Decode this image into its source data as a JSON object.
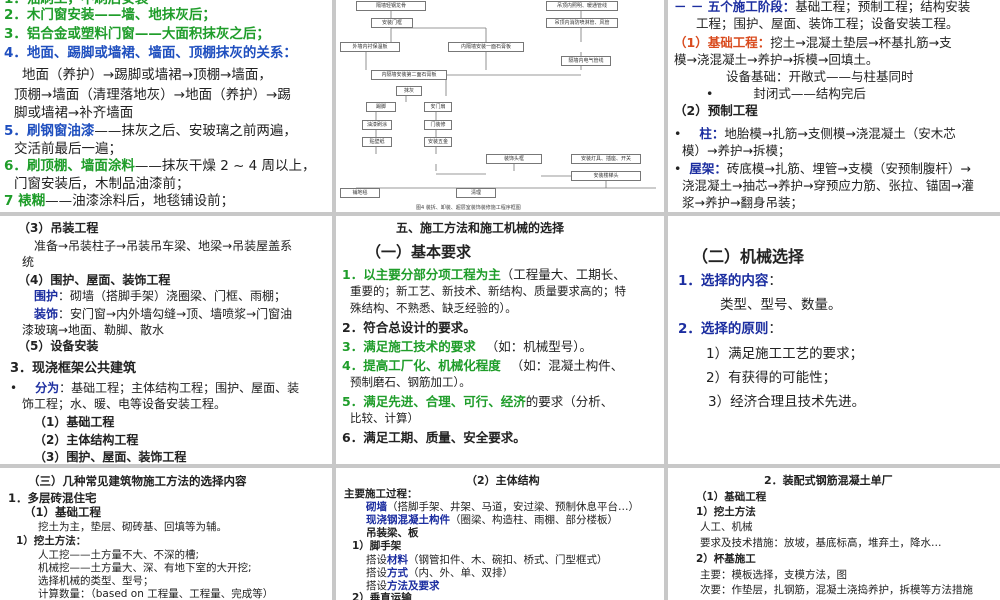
{
  "p1": {
    "l1": "2．木门窗安装——墙、地抹灰后；",
    "l2": "3．铝合金或塑料门窗——大面积抹灰之后；",
    "l3a": "4．地面、踢脚或墙裙、墙面、顶棚抹灰的关系：",
    "l4": "地面（养护）→踢脚或墙裙→顶棚→墙面，",
    "l5": "顶棚→墙面（清理落地灰）→地面（养护）→踢",
    "l6": "脚或墙裙→补齐墙面",
    "l7a": "5．刷钢窗油漆",
    "l7b": "——抹灰之后、安玻璃之前两遍，",
    "l8": "交活前最后一遍；",
    "l9a": "6．刷顶棚、墙面涂料",
    "l9b": "——抹灰干燥 2 ~ 4 周以上，",
    "l10": "门窗安装后，木制品油漆前；",
    "l11a": "7  裱糊",
    "l11b": "——油漆涂料后，地毯铺设前；"
  },
  "p2": {
    "boxes": [
      "隔墙轻钢龙骨",
      "吊顶内照明、暖通管线",
      "安装门框",
      "吊顶内消防喷淋管、风管",
      "外墙内衬保温板",
      "内隔墙安装一面石膏板",
      "隔墙内电气管线",
      "内隔墙安装第二面石膏板",
      "踢脚",
      "抹灰",
      "安门扇",
      "油漆刷涂",
      "门装修",
      "贴壁纸",
      "安装五金",
      "装饰头框",
      "安装灯具、插座、开关",
      "安装楼梯头",
      "铺地毯",
      "清理"
    ],
    "caption": "图4  装拆、卸装、超层室装饰装修施工程序框图"
  },
  "p3": {
    "l1a": "－ － 五个施工阶段：",
    "l1b": "基础工程；预制工程；结构安装",
    "l2": "工程；围护、屋面、装饰工程；设备安装工程。",
    "l3a": "（1）基础工程：",
    "l3b": "挖土→混凝土垫层→杯基扎筋→支",
    "l4": "模→浇混凝土→养护→拆模→回填土。",
    "l5": "设备基础：开敞式——与柱基同时",
    "l6a": "•",
    "l6b": "封闭式——结构完后",
    "l7": "（2）预制工程",
    "l8a": "•",
    "l8b": "柱：",
    "l8c": "地胎模→扎筋→支侧模→浇混凝土（安木芯",
    "l9": "模）→养护→拆模；",
    "l10a": "•",
    "l10b": "屋架：",
    "l10c": "砖底模→扎筋、埋管→支模（安预制腹杆）→",
    "l11": "浇混凝土→抽芯→养护→穿预应力筋、张拉、锚固→灌",
    "l12": "浆→养护→翻身吊装；"
  },
  "p4": {
    "l1": "（3）吊装工程",
    "l2": "准备→吊装柱子→吊装吊车梁、地梁→吊装屋盖系",
    "l3": "统",
    "l4": "（4）围护、屋面、装饰工程",
    "l5a": "围护",
    "l5b": "：砌墙（搭脚手架）浇圈梁、门框、雨棚；",
    "l6a": "装饰",
    "l6b": "：安门窗→内外墙勾缝→顶、墙喷浆→门窗油",
    "l7": "漆玻璃→地面、勒脚、散水",
    "l8": "（5）设备安装",
    "l9": "3．现浇框架公共建筑",
    "l10a": "•",
    "l10b": "分为",
    "l10c": "：基础工程；主体结构工程；围护、屋面、装",
    "l11": "饰工程；水、暖、电等设备安装工程。",
    "l12": "（1）基础工程",
    "l13": "（2）主体结构工程",
    "l14": "（3）围护、屋面、装饰工程"
  },
  "p5": {
    "title": "五、施工方法和施工机械的选择",
    "sub": "（一）基本要求",
    "i1a": "1．以主要分部分项工程为主",
    "i1b": "（工程量大、工期长、",
    "i1c": "重要的；新工艺、新技术、新结构、质量要求高的；特",
    "i1d": "殊结构、不熟悉、缺乏经验的）。",
    "i2": "2．符合总设计的要求。",
    "i3a": "3．满足施工技术的要求",
    "i3b": "（如：机械型号）。",
    "i4a": "4．提高工厂化、机械化程度",
    "i4b": "（如：混凝土构件、",
    "i4c": "预制磨石、钢筋加工）。",
    "i5a": "5．满足先进、合理、可行、经济",
    "i5b": "的要求（分析、",
    "i5c": "比较、计算）",
    "i6": "6．满足工期、质量、安全要求。"
  },
  "p6": {
    "title": "（二）机械选择",
    "i1a": "1．选择的内容",
    "i1b": "：",
    "i1c": "类型、型号、数量。",
    "i2a": "2．选择的原则",
    "i2b": "：",
    "i2c": "1）满足施工工艺的要求；",
    "i2d": "2）有获得的可能性；",
    "i2e": "3）经济合理且技术先进。"
  },
  "p7": {
    "title": "（三）几种常见建筑物施工方法的选择内容",
    "l1": "1．多层砖混住宅",
    "l2": "（1）基础工程",
    "l3": "挖土为主，垫层、砌砖基、回填等为辅。",
    "l4": "1）挖土方法：",
    "l5": "人工挖——土方量不大、不深的槽;",
    "l6": "机械挖——土方量大、深、有地下室的大开挖;",
    "l7": "选择机械的类型、型号；",
    "l8": "计算数量：（based on 工程量、工程量、完成等）"
  },
  "p8": {
    "title": "（2）主体结构",
    "l1": "主要施工过程：",
    "l2a": "砌墙",
    "l2b": "（搭脚手架、井架、马道，安过梁、预制休息平台…）",
    "l3a": "现浇钢混凝土构件",
    "l3b": "（圈梁、构造柱、雨棚、部分楼板）",
    "l4": "吊装梁、板",
    "l5": "1）脚手架",
    "l6a": "搭设",
    "l6b": "材料",
    "l6c": "（钢管扣件、木、碗扣、桥式、门型框式）",
    "l7a": "搭设",
    "l7b": "方式",
    "l7c": "（内、外、单、双排）",
    "l8a": "搭设",
    "l8b": "方法及要求",
    "l9": "2）垂直运输"
  },
  "p9": {
    "title": "2．装配式钢筋混凝土单厂",
    "l1": "（1）基础工程",
    "l2": "1）挖土方法",
    "l3": "人工、机械",
    "l4": "要求及技术措施：放坡，基底标高，堆弃土，降水…",
    "l5": "2）杯基施工",
    "l6": "主要：模板选择，支模方法，图",
    "l7": "次要：作垫层，扎钢筋，混凝土浇捣养护，拆模等方法措施"
  }
}
